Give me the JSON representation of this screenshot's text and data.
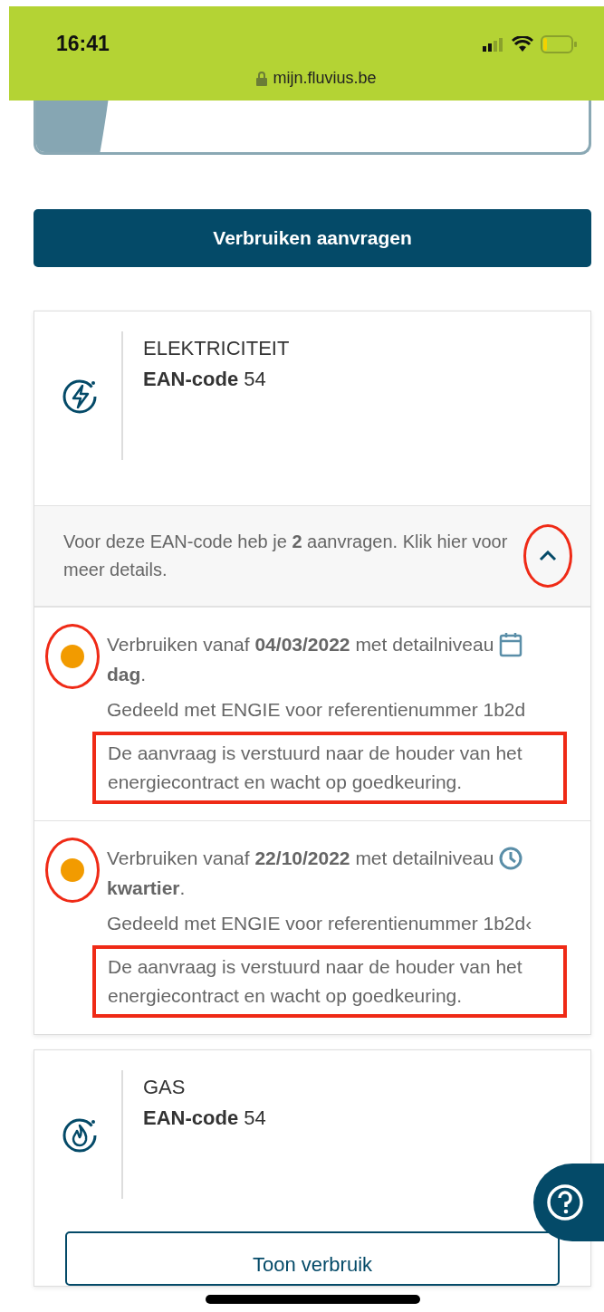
{
  "status_bar": {
    "time": "16:41",
    "url": "mijn.fluvius.be"
  },
  "request_button": {
    "label": "Verbruiken aanvragen"
  },
  "connections": [
    {
      "kind": "electricity",
      "title": "ELEKTRICITEIT",
      "ean": "**EAN-code** 54",
      "summary": {
        "text": "Voor deze EAN-code heb je **2** aanvragen. Klik hier voor meer details.",
        "expanded": true,
        "annotated": true
      },
      "requests": [
        {
          "color": "#f29b00",
          "annotated": true,
          "period": "Verbruiken vanaf **04/03/2022** met detailniveau",
          "kind": "calendar",
          "detail": "**dag**.",
          "shared": "Gedeeld met ENGIE voor referentienummer 1b2d",
          "message": "De aanvraag is verstuurd naar de houder van het energiecontract en wacht op goedkeuring."
        },
        {
          "color": "#f29b00",
          "annotated": true,
          "period": "Verbruiken vanaf **22/10/2022** met detailniveau",
          "kind": "clock",
          "detail": "**kwartier**.",
          "shared": "Gedeeld met ENGIE voor referentienummer 1b2d‹",
          "message": "De aanvraag is verstuurd naar de houder van het energiecontract en wacht op goedkeuring."
        }
      ]
    },
    {
      "kind": "gas",
      "title": "GAS",
      "ean": "**EAN-code** 54",
      "action": "Toon verbruik"
    }
  ]
}
